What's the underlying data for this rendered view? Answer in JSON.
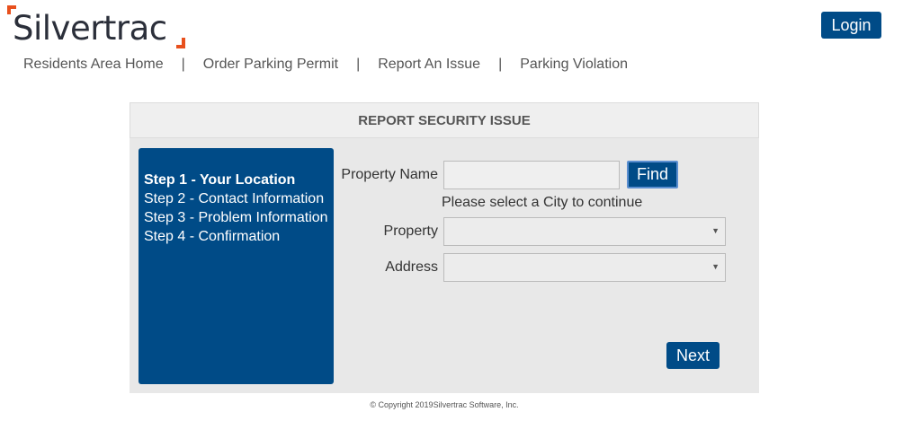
{
  "brand": {
    "logo_text": "Silvertrac",
    "accent_color": "#e8501d",
    "primary_color": "#004b87"
  },
  "header": {
    "login_label": "Login"
  },
  "nav": {
    "items": [
      "Residents Area Home",
      "Order Parking Permit",
      "Report An Issue",
      "Parking Violation"
    ],
    "separator": "|"
  },
  "panel": {
    "title": "REPORT SECURITY ISSUE",
    "steps": [
      {
        "label": "Step 1 - Your Location",
        "active": true
      },
      {
        "label": "Step 2 - Contact Information",
        "active": false
      },
      {
        "label": "Step 3 - Problem Information",
        "active": false
      },
      {
        "label": "Step 4 - Confirmation",
        "active": false
      }
    ],
    "form": {
      "property_name_label": "Property Name",
      "property_name_value": "",
      "find_label": "Find",
      "hint": "Please select a City to continue",
      "property_label": "Property",
      "property_value": "",
      "address_label": "Address",
      "address_value": "",
      "select_arrow": "▼"
    },
    "next_label": "Next"
  },
  "footer": {
    "copyright": "© Copyright 2019Silvertrac Software, Inc."
  }
}
